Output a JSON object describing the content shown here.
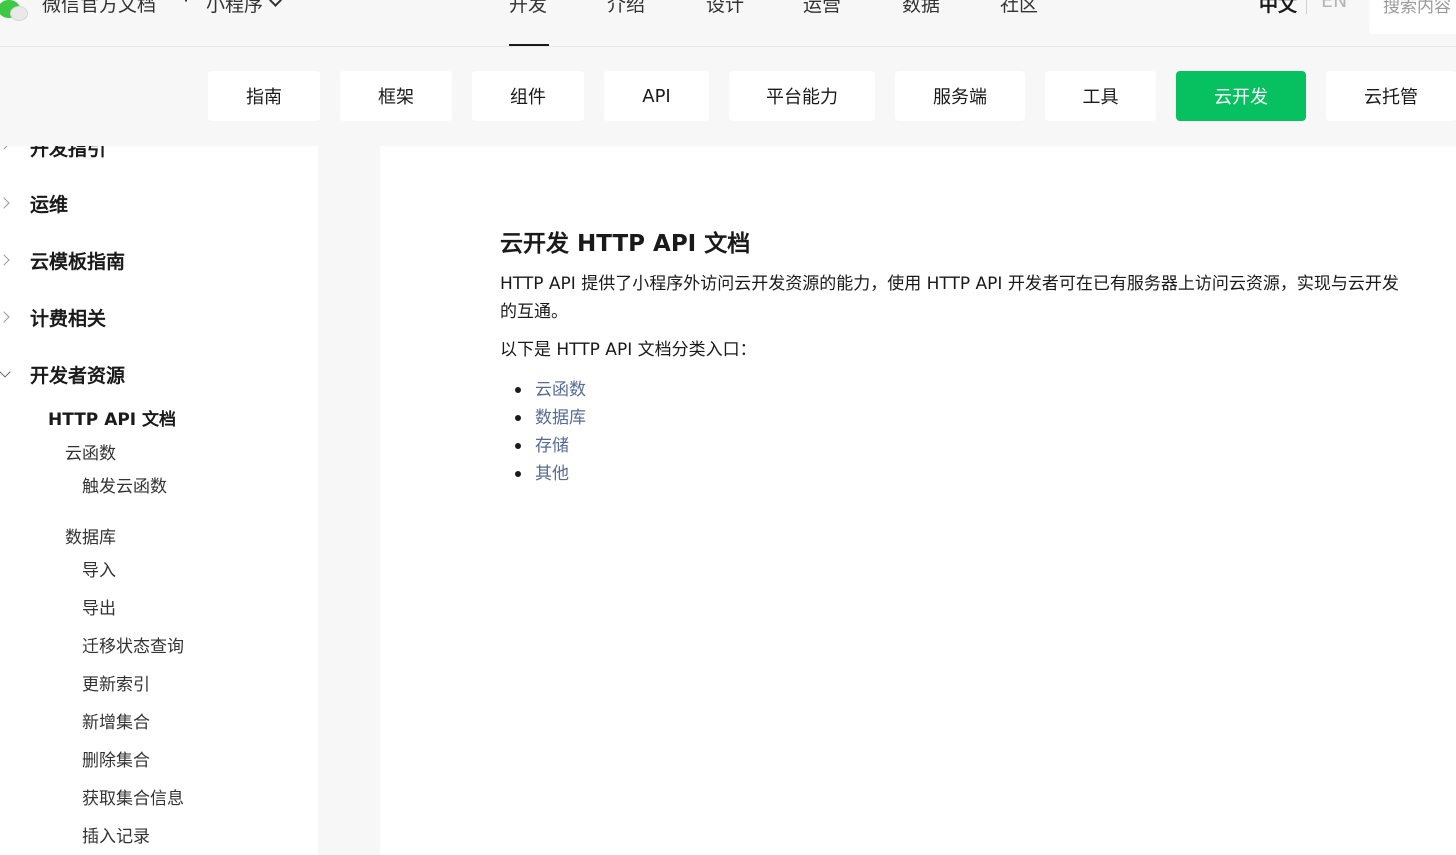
{
  "header": {
    "brand": "微信官方文档",
    "separator": "·",
    "product": "小程序",
    "nav": [
      "开发",
      "介绍",
      "设计",
      "运营",
      "数据",
      "社区"
    ],
    "active_nav": "开发",
    "lang_zh": "中文",
    "lang_en": "EN",
    "search_placeholder": "搜索内容"
  },
  "subnav": {
    "items": [
      "指南",
      "框架",
      "组件",
      "API",
      "平台能力",
      "服务端",
      "工具",
      "云开发",
      "云托管"
    ],
    "active": "云开发",
    "active_color": "#07c160"
  },
  "sidebar": {
    "groups": [
      {
        "label": "开发指引",
        "expanded": false
      },
      {
        "label": "运维",
        "expanded": false
      },
      {
        "label": "云模板指南",
        "expanded": false
      },
      {
        "label": "计费相关",
        "expanded": false
      },
      {
        "label": "开发者资源",
        "expanded": true
      }
    ],
    "sub": "HTTP API 文档",
    "cloud_function": {
      "label": "云函数",
      "children": [
        "触发云函数"
      ]
    },
    "database": {
      "label": "数据库",
      "children": [
        "导入",
        "导出",
        "迁移状态查询",
        "更新索引",
        "新增集合",
        "删除集合",
        "获取集合信息",
        "插入记录"
      ]
    }
  },
  "content": {
    "title": "云开发 HTTP API 文档",
    "desc": "HTTP API 提供了小程序外访问云开发资源的能力，使用 HTTP API 开发者可在已有服务器上访问云资源，实现与云开发的互通。",
    "intro": "以下是 HTTP API 文档分类入口：",
    "links": [
      "云函数",
      "数据库",
      "存储",
      "其他"
    ],
    "link_color": "#576b95"
  }
}
